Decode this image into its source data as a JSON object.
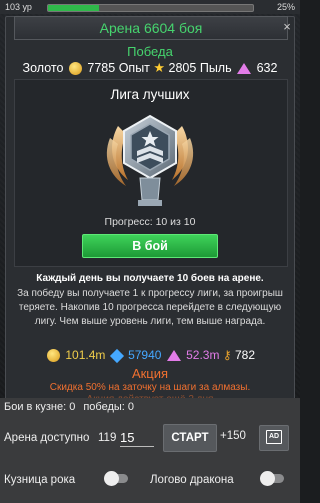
{
  "topbar": {
    "level": "103 ур",
    "xp_percent": "25%",
    "xp_fraction": 0.25
  },
  "header": {
    "title": "Арена 6604 боя",
    "close": "×"
  },
  "battle": {
    "result": "Победа",
    "gold_label": "Золото",
    "gold_value": "7785",
    "xp_label": "Опыт",
    "xp_value": "2805",
    "dust_label": "Пыль",
    "dust_value": "632"
  },
  "league": {
    "title": "Лига лучших",
    "progress": "Прогресс: 10 из 10",
    "fight_button": "В бой",
    "desc_bold": "Каждый день вы получаете 10 боев на арене.",
    "desc": "За победу вы получаете 1 к прогрессу лиги, за проигрыш теряете. Накопив 10 прогресса перейдете в следующую лигу. Чем выше уровень лиги, тем выше награда."
  },
  "resources": {
    "gold": "101.4m",
    "gems": "57940",
    "dust": "52.3m",
    "keys": "782"
  },
  "promo": {
    "title": "Акция",
    "text": "Скидка 50% на заточку на шаги за алмазы.",
    "text2": "Акция действует ещё 2 дня"
  },
  "controls": {
    "forge_battles_label": "Бои в кузне: 0",
    "wins_label": "победы: 0",
    "arena_label": "Арена доступно",
    "arena_available": "119",
    "arena_input_value": "15",
    "start_button": "СТАРТ",
    "plus_value": "+150",
    "ad_label": "AD",
    "forge_toggle_label": "Кузница рока",
    "dragon_toggle_label": "Логово дракона"
  },
  "colors": {
    "accent_green": "#46d46e",
    "promo_orange": "#f07030",
    "gold": "#f0cd4a",
    "gem_blue": "#45a8ff",
    "dust_pink": "#e27ce8"
  }
}
